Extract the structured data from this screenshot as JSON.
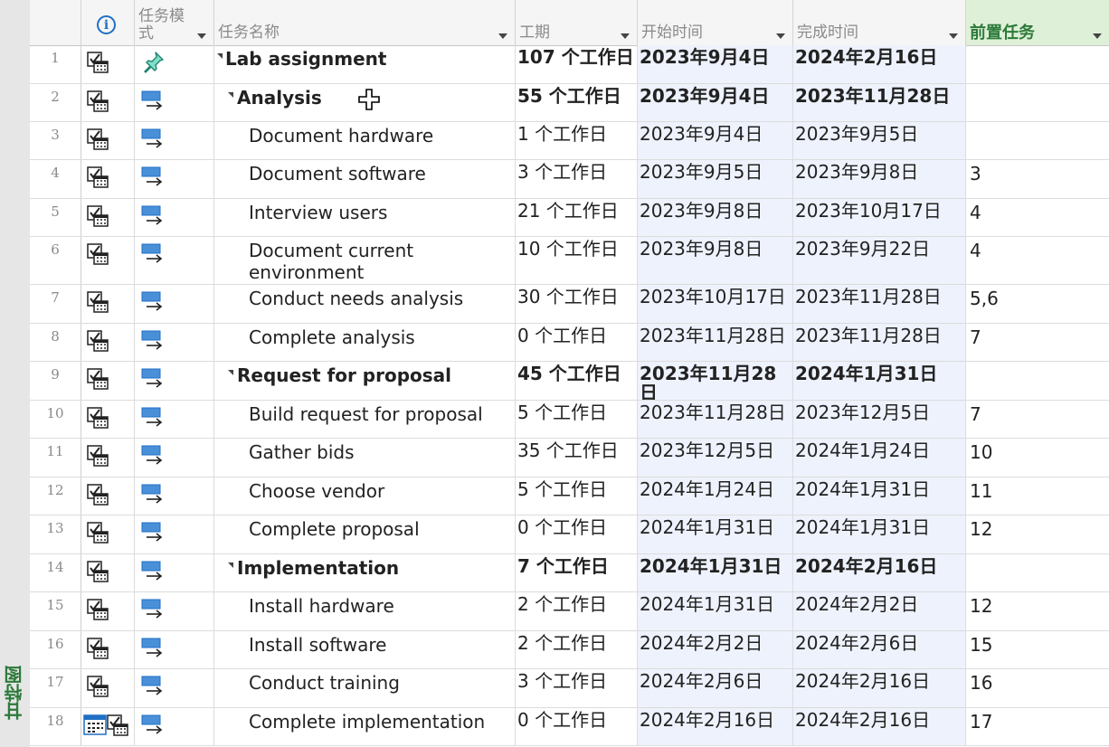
{
  "view_bar": {
    "label": "甘特图"
  },
  "colors": {
    "summary_accent": "#2c7a3a",
    "date_col_bg": "#eef2fc",
    "mode_icon": "#1f6fc5"
  },
  "headers": {
    "info": "i",
    "mode": "任务模式",
    "name": "任务名称",
    "duration": "工期",
    "start": "开始时间",
    "finish": "完成时间",
    "predecessors": "前置任务"
  },
  "rows": [
    {
      "id": "1",
      "level": 0,
      "summary": true,
      "mode": "manual-pin-icon",
      "name": "Lab assignment",
      "duration": "107 个工作日",
      "start": "2023年9月4日",
      "finish": "2024年2月16日",
      "pred": ""
    },
    {
      "id": "2",
      "level": 1,
      "summary": true,
      "mode": "auto-schedule-icon",
      "name": "Analysis",
      "duration": "55 个工作日",
      "start": "2023年9月4日",
      "finish": "2023年11月28日",
      "pred": ""
    },
    {
      "id": "3",
      "level": 2,
      "summary": false,
      "mode": "auto-schedule-icon",
      "name": "Document hardware",
      "duration": "1 个工作日",
      "start": "2023年9月4日",
      "finish": "2023年9月5日",
      "pred": ""
    },
    {
      "id": "4",
      "level": 2,
      "summary": false,
      "mode": "auto-schedule-icon",
      "name": "Document software",
      "duration": "3 个工作日",
      "start": "2023年9月5日",
      "finish": "2023年9月8日",
      "pred": "3"
    },
    {
      "id": "5",
      "level": 2,
      "summary": false,
      "mode": "auto-schedule-icon",
      "name": "Interview users",
      "duration": "21 个工作日",
      "start": "2023年9月8日",
      "finish": "2023年10月17日",
      "pred": "4"
    },
    {
      "id": "6",
      "level": 2,
      "summary": false,
      "mode": "auto-schedule-icon",
      "name": "Document current environment",
      "duration": "10 个工作日",
      "start": "2023年9月8日",
      "finish": "2023年9月22日",
      "pred": "4"
    },
    {
      "id": "7",
      "level": 2,
      "summary": false,
      "mode": "auto-schedule-icon",
      "name": "Conduct needs analysis",
      "duration": "30 个工作日",
      "start": "2023年10月17日",
      "finish": "2023年11月28日",
      "pred": "5,6"
    },
    {
      "id": "8",
      "level": 2,
      "summary": false,
      "mode": "auto-schedule-icon",
      "name": "Complete analysis",
      "duration": "0 个工作日",
      "start": "2023年11月28日",
      "finish": "2023年11月28日",
      "pred": "7"
    },
    {
      "id": "9",
      "level": 1,
      "summary": true,
      "mode": "auto-schedule-icon",
      "name": "Request for proposal",
      "duration": "45 个工作日",
      "start": "2023年11月28日",
      "finish": "2024年1月31日",
      "pred": ""
    },
    {
      "id": "10",
      "level": 2,
      "summary": false,
      "mode": "auto-schedule-icon",
      "name": "Build request for proposal",
      "duration": "5 个工作日",
      "start": "2023年11月28日",
      "finish": "2023年12月5日",
      "pred": "7"
    },
    {
      "id": "11",
      "level": 2,
      "summary": false,
      "mode": "auto-schedule-icon",
      "name": "Gather bids",
      "duration": "35 个工作日",
      "start": "2023年12月5日",
      "finish": "2024年1月24日",
      "pred": "10"
    },
    {
      "id": "12",
      "level": 2,
      "summary": false,
      "mode": "auto-schedule-icon",
      "name": "Choose vendor",
      "duration": "5 个工作日",
      "start": "2024年1月24日",
      "finish": "2024年1月31日",
      "pred": "11"
    },
    {
      "id": "13",
      "level": 2,
      "summary": false,
      "mode": "auto-schedule-icon",
      "name": "Complete proposal",
      "duration": "0 个工作日",
      "start": "2024年1月31日",
      "finish": "2024年1月31日",
      "pred": "12"
    },
    {
      "id": "14",
      "level": 1,
      "summary": true,
      "mode": "auto-schedule-icon",
      "name": "Implementation",
      "duration": "7 个工作日",
      "start": "2024年1月31日",
      "finish": "2024年2月16日",
      "pred": ""
    },
    {
      "id": "15",
      "level": 2,
      "summary": false,
      "mode": "auto-schedule-icon",
      "name": "Install hardware",
      "duration": "2 个工作日",
      "start": "2024年1月31日",
      "finish": "2024年2月2日",
      "pred": "12"
    },
    {
      "id": "16",
      "level": 2,
      "summary": false,
      "mode": "auto-schedule-icon",
      "name": "Install software",
      "duration": "2 个工作日",
      "start": "2024年2月2日",
      "finish": "2024年2月6日",
      "pred": "15"
    },
    {
      "id": "17",
      "level": 2,
      "summary": false,
      "mode": "auto-schedule-icon",
      "name": "Conduct training",
      "duration": "3 个工作日",
      "start": "2024年2月6日",
      "finish": "2024年2月16日",
      "pred": "16"
    },
    {
      "id": "18",
      "level": 2,
      "summary": false,
      "mode": "auto-schedule-icon",
      "name": "Complete implementation",
      "duration": "0 个工作日",
      "start": "2024年2月16日",
      "finish": "2024年2月16日",
      "pred": "17"
    }
  ]
}
